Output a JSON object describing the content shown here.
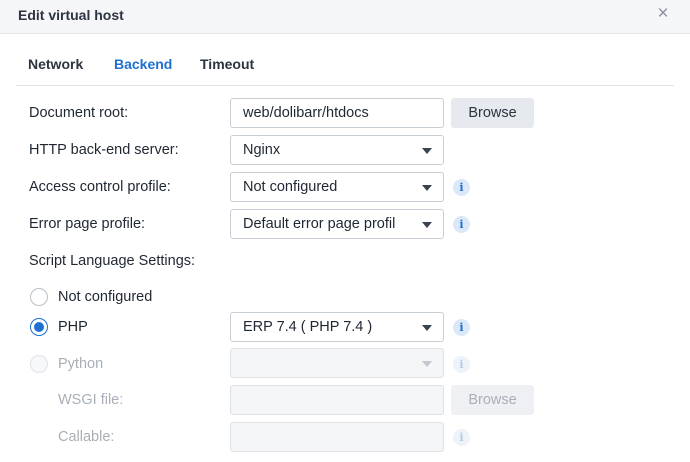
{
  "dialog": {
    "title": "Edit virtual host",
    "close_icon": "×"
  },
  "tabs": [
    {
      "label": "Network",
      "active": false
    },
    {
      "label": "Backend",
      "active": true
    },
    {
      "label": "Timeout",
      "active": false
    }
  ],
  "form": {
    "document_root": {
      "label": "Document root:",
      "value": "web/dolibarr/htdocs",
      "button": "Browse"
    },
    "http_backend": {
      "label": "HTTP back-end server:",
      "value": "Nginx"
    },
    "access_control": {
      "label": "Access control profile:",
      "value": "Not configured",
      "info_icon": "i"
    },
    "error_page": {
      "label": "Error page profile:",
      "value": "Default error page profil",
      "info_icon": "i"
    },
    "script_settings_label": "Script Language Settings:",
    "options": {
      "not_configured": {
        "label": "Not configured",
        "checked": false
      },
      "php": {
        "label": "PHP",
        "checked": true,
        "value": "ERP 7.4 ( PHP 7.4 )",
        "info_icon": "i"
      },
      "python": {
        "label": "Python",
        "checked": false,
        "disabled": true,
        "value": "",
        "info_icon": "i"
      }
    },
    "wsgi_file": {
      "label": "WSGI file:",
      "value": "",
      "button": "Browse"
    },
    "callable": {
      "label": "Callable:",
      "value": "",
      "info_icon": "i"
    }
  },
  "colors": {
    "accent": "#1f6fd1",
    "disabled_text": "#a8afb8"
  }
}
